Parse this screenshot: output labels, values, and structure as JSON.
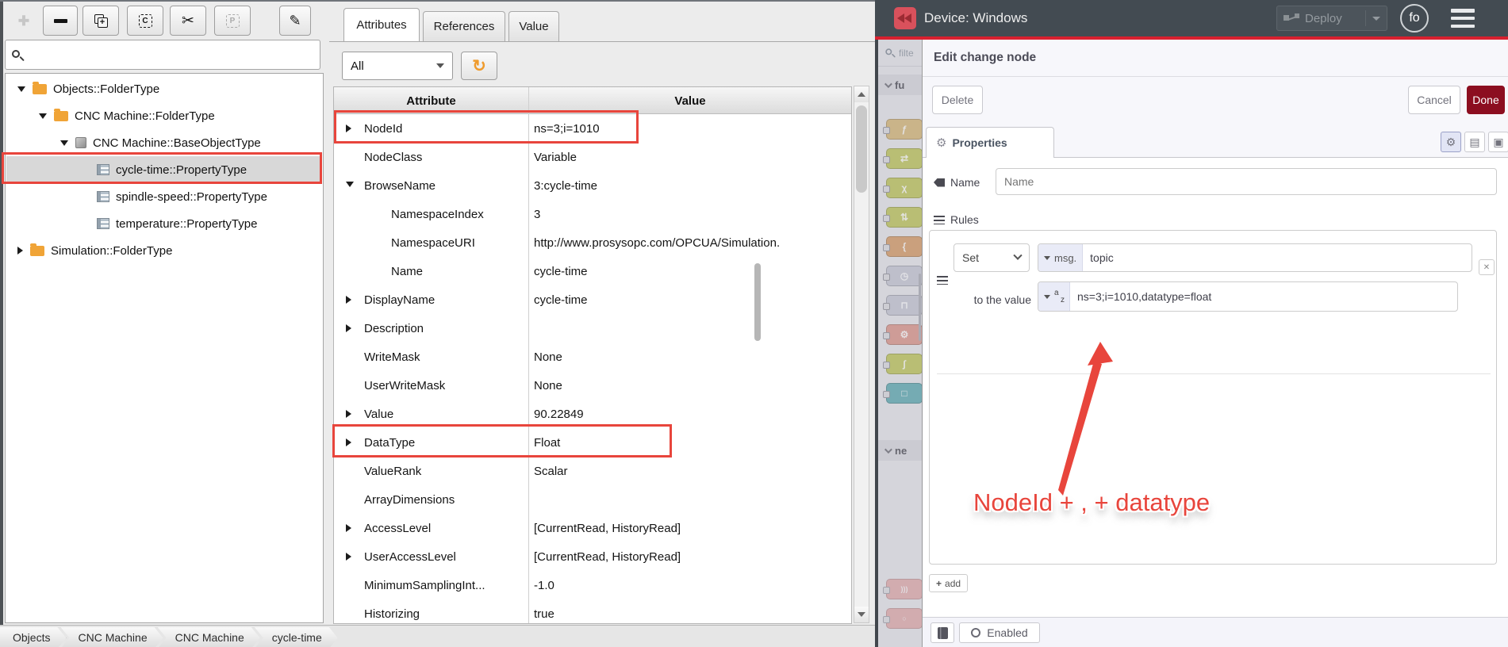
{
  "annotation_color": "#e8453c",
  "left_app": {
    "toolbar": {
      "buttons": [
        {
          "icon": "plus",
          "disabled": true
        },
        {
          "icon": "minus",
          "disabled": false
        },
        {
          "icon": "duplicate",
          "disabled": false
        },
        {
          "icon": "copy",
          "disabled": false
        },
        {
          "icon": "cut",
          "disabled": false
        },
        {
          "icon": "paste",
          "disabled": true
        },
        {
          "icon": "edit",
          "disabled": false
        }
      ]
    },
    "search": {
      "value": ""
    },
    "tree": [
      {
        "label": "Objects::FolderType",
        "depth": 0,
        "expander": "open",
        "icon": "folder",
        "selected": false,
        "annotated": false
      },
      {
        "label": "CNC Machine::FolderType",
        "depth": 1,
        "expander": "open",
        "icon": "folder",
        "selected": false,
        "annotated": false
      },
      {
        "label": "CNC Machine::BaseObjectType",
        "depth": 2,
        "expander": "open",
        "icon": "cube",
        "selected": false,
        "annotated": false
      },
      {
        "label": "cycle-time::PropertyType",
        "depth": 3,
        "expander": null,
        "icon": "property",
        "selected": true,
        "annotated": true
      },
      {
        "label": "spindle-speed::PropertyType",
        "depth": 3,
        "expander": null,
        "icon": "property",
        "selected": false,
        "annotated": false
      },
      {
        "label": "temperature::PropertyType",
        "depth": 3,
        "expander": null,
        "icon": "property",
        "selected": false,
        "annotated": false
      },
      {
        "label": "Simulation::FolderType",
        "depth": 0,
        "expander": "closed",
        "icon": "folder",
        "selected": false,
        "annotated": false
      }
    ],
    "tabs": {
      "items": [
        "Attributes",
        "References",
        "Value"
      ],
      "active": 0
    },
    "filter_dropdown": "All",
    "attributes_table": {
      "columns": [
        "Attribute",
        "Value"
      ],
      "rows": [
        {
          "attr": "NodeId",
          "value": "ns=3;i=1010",
          "expander": "closed",
          "indent": 0,
          "annotated": true
        },
        {
          "attr": "NodeClass",
          "value": "Variable",
          "expander": null,
          "indent": 0,
          "annotated": false
        },
        {
          "attr": "BrowseName",
          "value": "3:cycle-time",
          "expander": "open",
          "indent": 0,
          "annotated": false
        },
        {
          "attr": "NamespaceIndex",
          "value": "3",
          "expander": null,
          "indent": 1,
          "annotated": false
        },
        {
          "attr": "NamespaceURI",
          "value": "http://www.prosysopc.com/OPCUA/Simulation.",
          "expander": null,
          "indent": 1,
          "annotated": false
        },
        {
          "attr": "Name",
          "value": "cycle-time",
          "expander": null,
          "indent": 1,
          "annotated": false
        },
        {
          "attr": "DisplayName",
          "value": "cycle-time",
          "expander": "closed",
          "indent": 0,
          "annotated": false
        },
        {
          "attr": "Description",
          "value": "",
          "expander": "closed",
          "indent": 0,
          "annotated": false
        },
        {
          "attr": "WriteMask",
          "value": "None",
          "expander": null,
          "indent": 0,
          "annotated": false
        },
        {
          "attr": "UserWriteMask",
          "value": "None",
          "expander": null,
          "indent": 0,
          "annotated": false
        },
        {
          "attr": "Value",
          "value": "90.22849",
          "expander": "closed",
          "indent": 0,
          "annotated": false
        },
        {
          "attr": "DataType",
          "value": "Float",
          "expander": "closed",
          "indent": 0,
          "annotated": true
        },
        {
          "attr": "ValueRank",
          "value": "Scalar",
          "expander": null,
          "indent": 0,
          "annotated": false
        },
        {
          "attr": "ArrayDimensions",
          "value": "",
          "expander": null,
          "indent": 0,
          "annotated": false
        },
        {
          "attr": "AccessLevel",
          "value": "[CurrentRead, HistoryRead]",
          "expander": "closed",
          "indent": 0,
          "annotated": false
        },
        {
          "attr": "UserAccessLevel",
          "value": "[CurrentRead, HistoryRead]",
          "expander": "closed",
          "indent": 0,
          "annotated": false
        },
        {
          "attr": "MinimumSamplingInt...",
          "value": "-1.0",
          "expander": null,
          "indent": 0,
          "annotated": false
        },
        {
          "attr": "Historizing",
          "value": "true",
          "expander": null,
          "indent": 0,
          "annotated": false
        }
      ]
    },
    "breadcrumbs": [
      "Objects",
      "CNC Machine",
      "CNC Machine",
      "cycle-time"
    ]
  },
  "right_app": {
    "header": {
      "title": "Device: Windows",
      "deploy_label": "Deploy",
      "avatar_label": "fo"
    },
    "palette": {
      "search_placeholder": "filte",
      "categories": [
        {
          "label": "fu"
        },
        {
          "label": "ne"
        }
      ],
      "nodes": [
        {
          "icon": "function",
          "color": "#dcbf85"
        },
        {
          "icon": "switch",
          "color": "#c6cc6a"
        },
        {
          "icon": "change",
          "color": "#c6cc6a"
        },
        {
          "icon": "range",
          "color": "#c6cc6a"
        },
        {
          "icon": "template",
          "color": "#dba675"
        },
        {
          "icon": "delay",
          "color": "#ccced9"
        },
        {
          "icon": "trigger",
          "color": "#ccced9"
        },
        {
          "icon": "exec",
          "color": "#e0a196"
        },
        {
          "icon": "filter",
          "color": "#c6cc6a"
        },
        {
          "icon": "link",
          "color": "#6fb4ba"
        }
      ],
      "bottom_nodes": [
        {
          "icon": "mqtt",
          "color": "#e6a8a8"
        },
        {
          "icon": "http",
          "color": "#e6a8a8"
        }
      ]
    },
    "editor": {
      "title": "Edit change node",
      "delete_label": "Delete",
      "cancel_label": "Cancel",
      "done_label": "Done",
      "properties_tab": "Properties",
      "name_label": "Name",
      "name_placeholder": "Name",
      "rules_label": "Rules",
      "rule": {
        "action": "Set",
        "target_prefix": "msg.",
        "target": "topic",
        "to_label": "to the value",
        "value": "ns=3;i=1010,datatype=float"
      },
      "add_label": "add",
      "enabled_label": "Enabled"
    },
    "annotation": {
      "text": "NodeId + , + datatype"
    }
  }
}
